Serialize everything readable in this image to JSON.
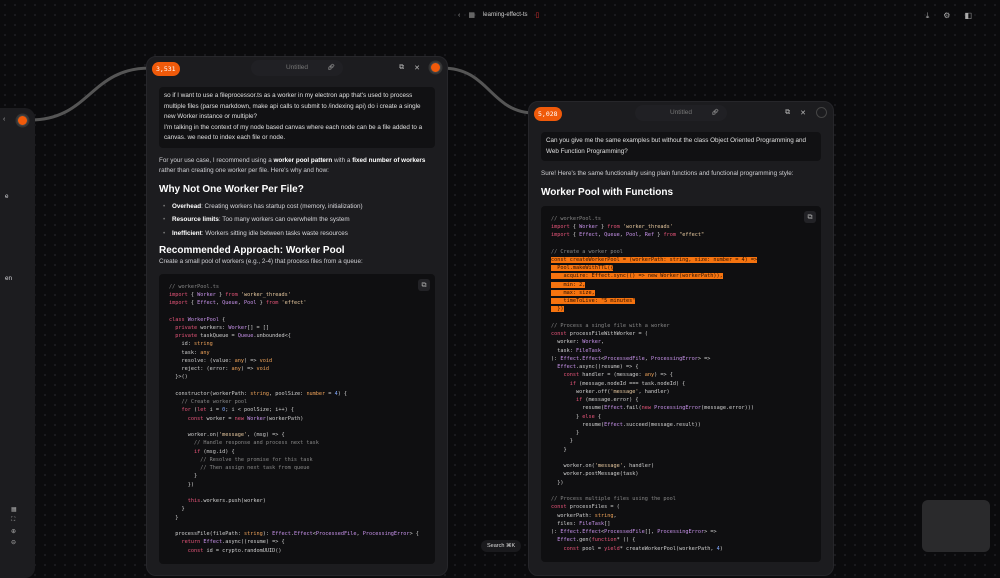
{
  "topbar": {
    "back": "‹",
    "project": "learning-effect-ts"
  },
  "search": {
    "label": "Search",
    "shortcut": "⌘K"
  },
  "left_fragments": [
    "e",
    "en"
  ],
  "node1": {
    "count": "3,531",
    "title": "Untitled",
    "user_msg": [
      "so if I want to use a fileprocessor.ts as a worker in my electron app that's used to process multiple files (parse markdown, make api calls to submit to /indexing api) do i create a single new Worker instance or multiple?",
      "I'm talking in the context of my node based canvas where each node can be a file added to a canvas. we need to index each file or node."
    ],
    "intro": [
      "For your use case, I recommend using a ",
      "worker pool pattern",
      " with a ",
      "fixed number of workers",
      " rather than creating one worker per file. Here's why and how:"
    ],
    "h1": "Why Not One Worker Per File?",
    "bullets": [
      {
        "b": "Overhead",
        "t": ": Creating workers has startup cost (memory, initialization)"
      },
      {
        "b": "Resource limits",
        "t": ": Too many workers can overwhelm the system"
      },
      {
        "b": "Inefficient",
        "t": ": Workers sitting idle between tasks waste resources"
      }
    ],
    "h2": "Recommended Approach: Worker Pool",
    "p2": "Create a small pool of workers (e.g., 2-4) that process files from a queue:",
    "code": [
      "// workerPool.ts",
      "import { Worker } from 'worker_threads'",
      "import { Effect, Queue, Pool } from 'effect'",
      "",
      "class WorkerPool {",
      "  private workers: Worker[] = []",
      "  private taskQueue = Queue.unbounded<{",
      "    id: string",
      "    task: any",
      "    resolve: (value: any) => void",
      "    reject: (error: any) => void",
      "  }>()",
      "",
      "  constructor(workerPath: string, poolSize: number = 4) {",
      "    // Create worker pool",
      "    for (let i = 0; i < poolSize; i++) {",
      "      const worker = new Worker(workerPath)",
      "",
      "      worker.on('message', (msg) => {",
      "        // Handle response and process next task",
      "        if (msg.id) {",
      "          // Resolve the promise for this task",
      "          // Then assign next task from queue",
      "        }",
      "      })",
      "",
      "      this.workers.push(worker)",
      "    }",
      "  }",
      "",
      "  processFile(filePath: string): Effect.Effect<ProcessedFile, ProcessingError> {",
      "    return Effect.async((resume) => {",
      "      const id = crypto.randomUUID()"
    ]
  },
  "node2": {
    "count": "5,028",
    "title": "Untitled",
    "user_msg": [
      "Can you give me the same examples but without the class Object Oriented Programming and Web Function Programming?"
    ],
    "intro": "Sure! Here's the same functionality using plain functions and functional programming style:",
    "h1": "Worker Pool with Functions",
    "highlight_lines": [
      5,
      6,
      7,
      8,
      9,
      10,
      11
    ],
    "code": [
      "// workerPool.ts",
      "import { Worker } from 'worker_threads'",
      "import { Effect, Queue, Pool, Ref } from \"effect\"",
      "",
      "// Create a worker pool",
      "const createWorkerPool = (workerPath: string, size: number = 4) =>",
      "  Pool.makeWithTTL({",
      "    acquire: Effect.sync(() => new Worker(workerPath)),",
      "    min: 2,",
      "    max: size,",
      "    timeToLive: \"5 minutes\"",
      "  })",
      "",
      "// Process a single file with a worker",
      "const processFileWithWorker = (",
      "  worker: Worker,",
      "  task: FileTask",
      "): Effect.Effect<ProcessedFile, ProcessingError> =>",
      "  Effect.async((resume) => {",
      "    const handler = (message: any) => {",
      "      if (message.nodeId === task.nodeId) {",
      "        worker.off('message', handler)",
      "        if (message.error) {",
      "          resume(Effect.fail(new ProcessingError(message.error)))",
      "        } else {",
      "          resume(Effect.succeed(message.result))",
      "        }",
      "      }",
      "    }",
      "",
      "    worker.on('message', handler)",
      "    worker.postMessage(task)",
      "  })",
      "",
      "// Process multiple files using the pool",
      "const processFiles = (",
      "  workerPath: string,",
      "  files: FileTask[]",
      "): Effect.Effect<ProcessedFile[], ProcessingError> =>",
      "  Effect.gen(function* () {",
      "    const pool = yield* createWorkerPool(workerPath, 4)"
    ]
  },
  "colors": {
    "accent": "#f05a0a",
    "highlight": "#f5730f"
  }
}
